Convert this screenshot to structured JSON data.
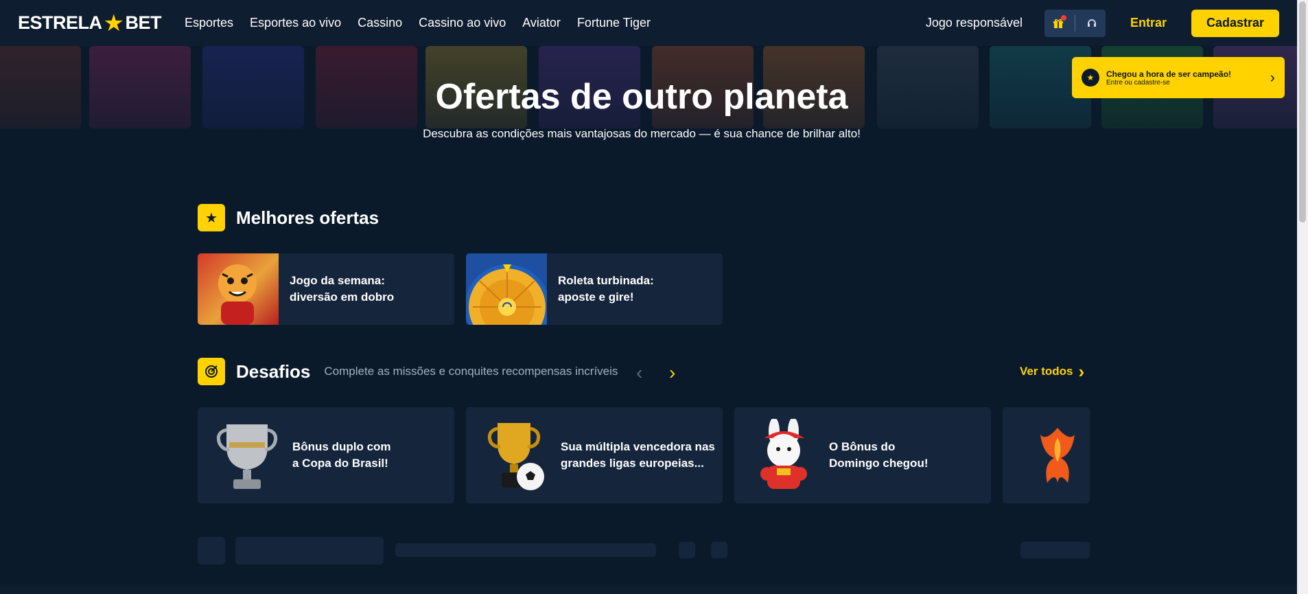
{
  "header": {
    "logo_left": "ESTRELA",
    "logo_right": "BET",
    "nav": [
      "Esportes",
      "Esportes ao vivo",
      "Cassino",
      "Cassino ao vivo",
      "Aviator",
      "Fortune Tiger"
    ],
    "responsible": "Jogo responsável",
    "login": "Entrar",
    "register": "Cadastrar"
  },
  "hero": {
    "title": "Ofertas de outro planeta",
    "subtitle": "Descubra as condições mais vantajosas do mercado — é sua chance de brilhar alto!"
  },
  "toast": {
    "title": "Chegou a hora de ser campeão!",
    "subtitle": "Entre ou cadastre-se"
  },
  "offers": {
    "title": "Melhores ofertas",
    "items": [
      {
        "line1": "Jogo da semana:",
        "line2": "diversão em dobro"
      },
      {
        "line1": "Roleta turbinada:",
        "line2": "aposte e gire!"
      }
    ]
  },
  "challenges": {
    "title": "Desafios",
    "description": "Complete as missões e conquites recompensas incríveis",
    "see_all": "Ver todos",
    "items": [
      {
        "line1": "Bônus duplo com",
        "line2": "a Copa do Brasil!"
      },
      {
        "line1": "Sua múltipla vencedora nas",
        "line2": "grandes ligas europeias..."
      },
      {
        "line1": "O Bônus do",
        "line2": "Domingo chegou!"
      }
    ]
  },
  "colors": {
    "accent": "#ffd200",
    "background": "#0b1a2b",
    "card": "#15263c"
  }
}
